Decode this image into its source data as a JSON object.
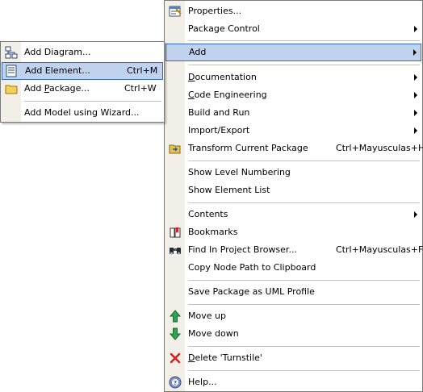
{
  "main_menu": {
    "items": [
      {
        "label": "Properties...",
        "icon": "properties-icon"
      },
      {
        "label": "Package Control",
        "submenu": true
      },
      {
        "label": "Add",
        "submenu": true,
        "highlighted": true
      },
      {
        "label": "Documentation",
        "underline": "D",
        "submenu": true
      },
      {
        "label": "Code Engineering",
        "underline": "C",
        "submenu": true
      },
      {
        "label": "Build and Run",
        "submenu": true
      },
      {
        "label": "Import/Export",
        "submenu": true
      },
      {
        "label": "Transform Current Package",
        "icon": "transform-icon",
        "shortcut": "Ctrl+Mayusculas+H"
      },
      {
        "label": "Show Level Numbering"
      },
      {
        "label": "Show Element List"
      },
      {
        "label": "Contents",
        "submenu": true
      },
      {
        "label": "Bookmarks",
        "icon": "bookmarks-icon"
      },
      {
        "label": "Find In Project Browser...",
        "icon": "binoculars-icon",
        "shortcut": "Ctrl+Mayusculas+F"
      },
      {
        "label": "Copy Node Path to Clipboard"
      },
      {
        "label": "Save Package as UML Profile"
      },
      {
        "label": "Move up",
        "icon": "arrow-up-icon"
      },
      {
        "label": "Move down",
        "icon": "arrow-down-icon"
      },
      {
        "label": "Delete 'Turnstile'",
        "underline": "D",
        "icon": "delete-icon"
      },
      {
        "label": "Help...",
        "icon": "help-icon"
      }
    ]
  },
  "add_submenu": {
    "items": [
      {
        "label": "Add Diagram...",
        "icon": "diagram-icon"
      },
      {
        "label": "Add Element...",
        "icon": "element-icon",
        "shortcut": "Ctrl+M",
        "highlighted": true
      },
      {
        "label": "Add Package...",
        "icon": "package-icon",
        "shortcut": "Ctrl+W",
        "underline": "P"
      },
      {
        "label": "Add Model using Wizard..."
      }
    ]
  },
  "colors": {
    "highlight_fill": "#c1d2ee",
    "highlight_border": "#316ac5",
    "icon_column": "#f1efe7"
  }
}
